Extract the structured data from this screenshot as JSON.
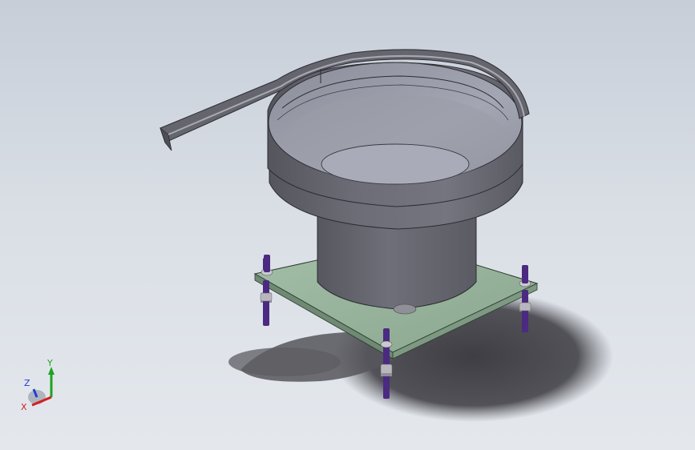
{
  "viewport": {
    "background_top": "#c7ced8",
    "background_bottom": "#e4e8ed"
  },
  "model": {
    "bowl_color": "#6e6e78",
    "bowl_inner_color": "#9496a2",
    "plate_color": "#97b39c",
    "rod_color": "#4b2a82",
    "nut_color": "#b7b7bd"
  },
  "triad": {
    "x_label": "X",
    "y_label": "Y",
    "z_label": "Z",
    "x_color": "#d11f1f",
    "y_color": "#1fa31f",
    "z_color": "#1f3fd1"
  }
}
